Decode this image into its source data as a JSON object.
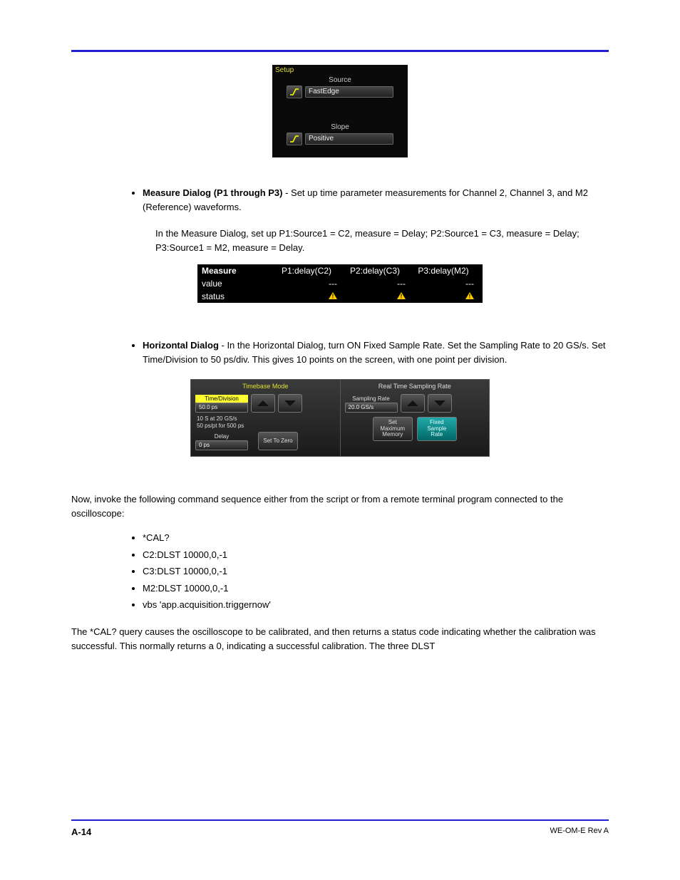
{
  "setup": {
    "title": "Setup",
    "source_label": "Source",
    "source_value": "FastEdge",
    "slope_label": "Slope",
    "slope_value": "Positive"
  },
  "bullet1": {
    "lead": "Measure Dialog (P1 through P3) ",
    "rest": "- Set up time parameter measurements for Channel 2, Channel 3, and M2 (Reference) waveforms."
  },
  "bullet1_para": "In the Measure Dialog, set up P1:Source1 = C2, measure = Delay; P2:Source1 = C3, measure = Delay; P3:Source1 = M2, measure = Delay.",
  "measure": {
    "h0": "Measure",
    "h1": "P1:delay(C2)",
    "h2": "P2:delay(C3)",
    "h3": "P3:delay(M2)",
    "r1": "value",
    "r1v": "---",
    "r2": "status"
  },
  "bullet2": {
    "lead": "Horizontal Dialog ",
    "rest": "- In the Horizontal Dialog, turn ON Fixed Sample Rate. Set the Sampling Rate to 20 GS/s. Set Time/Division to 50 ps/div. This gives 10 points on the screen, with one point per division."
  },
  "timebase": {
    "left_title": "Timebase Mode",
    "right_title": "Real Time Sampling Rate",
    "time_div_label": "Time/Division",
    "time_div_value": "50.0 ps",
    "info_line1": "10 S at 20 GS/s",
    "info_line2": "50 ps/pt for 500 ps",
    "delay_label": "Delay",
    "delay_value": "0 ps",
    "set_zero": "Set To Zero",
    "sampling_rate_label": "Sampling Rate",
    "sampling_rate_value": "20.0 GS/s",
    "set_max_mem": "Set Maximum Memory",
    "fixed_rate": "Fixed Sample Rate"
  },
  "sequence_intro": "Now, invoke the following command sequence either from the script or from a remote terminal program connected to the oscilloscope:",
  "cmds": {
    "c1": "*CAL?",
    "c2": "C2:DLST 10000,0,-1",
    "c3": "C3:DLST 10000,0,-1",
    "c4": "M2:DLST 10000,0,-1",
    "c5": "vbs 'app.acquisition.triggernow' "
  },
  "para_after": "The *CAL? query causes the oscilloscope to be calibrated, and then returns a status code indicating whether the calibration was successful. This normally returns a 0, indicating a successful calibration. The three DLST",
  "footer": {
    "page": "A-14",
    "doc": "WE-OM-E Rev A"
  }
}
